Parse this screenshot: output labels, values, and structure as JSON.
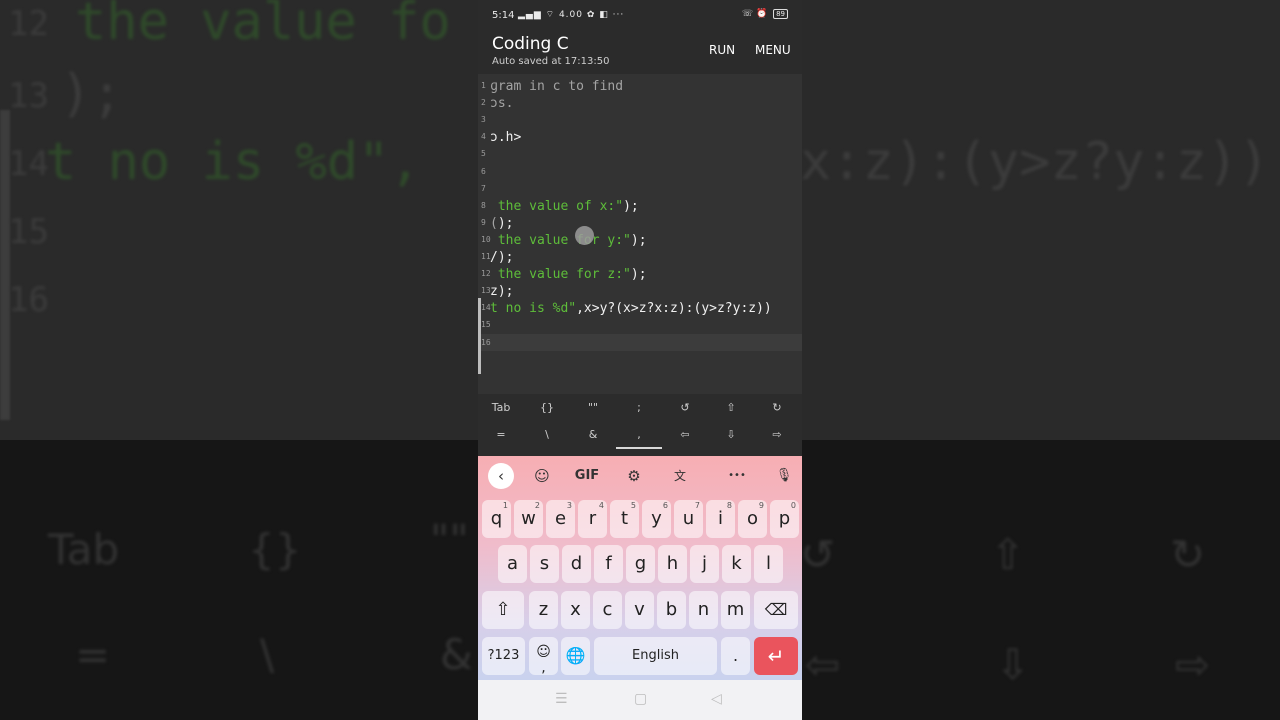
{
  "background": {
    "code_lines": [
      {
        "ln": "12",
        "text": "the value fo"
      },
      {
        "ln": "13",
        "text": ");"
      },
      {
        "ln": "14",
        "text": "t no is %d\",",
        "tail": "x:z):(y>z?y:z))"
      },
      {
        "ln": "15",
        "text": ""
      },
      {
        "ln": "16",
        "text": ""
      }
    ],
    "keys_row1": [
      "Tab",
      "{}",
      "\"\"",
      "↺",
      "⇧",
      "↻"
    ],
    "keys_row2": [
      "=",
      "\\",
      "&",
      "⇦",
      "⇩",
      "⇨"
    ]
  },
  "status_bar": {
    "time": "5:14",
    "indicators": "▂▄▆ ⌔ 4.00 ✿ ◧ ···",
    "right_icons": "☏ ⏰",
    "battery": "89"
  },
  "app": {
    "title": "Coding C",
    "subtitle": "Auto saved at 17:13:50",
    "run_label": "RUN",
    "menu_label": "MENU"
  },
  "editor": {
    "lines": [
      {
        "ln": "1",
        "parts": [
          {
            "t": "ɡram in c to find",
            "c": "c"
          }
        ]
      },
      {
        "ln": "2",
        "parts": [
          {
            "t": "ɔs.",
            "c": "c"
          }
        ]
      },
      {
        "ln": "3",
        "parts": []
      },
      {
        "ln": "4",
        "parts": [
          {
            "t": "ɔ.h>",
            "c": ""
          }
        ]
      },
      {
        "ln": "5",
        "parts": []
      },
      {
        "ln": "6",
        "parts": []
      },
      {
        "ln": "7",
        "parts": []
      },
      {
        "ln": "8",
        "parts": [
          {
            "t": " the value of x:\"",
            "c": "g"
          },
          {
            "t": ");",
            "c": ""
          }
        ]
      },
      {
        "ln": "9",
        "parts": [
          {
            "t": "(",
            "c": "c"
          },
          {
            "t": ");",
            "c": ""
          }
        ]
      },
      {
        "ln": "10",
        "parts": [
          {
            "t": " the value for y:\"",
            "c": "g"
          },
          {
            "t": ");",
            "c": ""
          }
        ]
      },
      {
        "ln": "11",
        "parts": [
          {
            "t": "/);",
            "c": ""
          }
        ]
      },
      {
        "ln": "12",
        "parts": [
          {
            "t": " the value for z:\"",
            "c": "g"
          },
          {
            "t": ");",
            "c": ""
          }
        ]
      },
      {
        "ln": "13",
        "parts": [
          {
            "t": "z);",
            "c": ""
          }
        ]
      },
      {
        "ln": "14",
        "parts": [
          {
            "t": "t no is %d\"",
            "c": "g"
          },
          {
            "t": ",x>y?(x>z?x:z):(y>z?y:z))",
            "c": ""
          }
        ]
      },
      {
        "ln": "15",
        "parts": []
      },
      {
        "ln": "16",
        "parts": []
      }
    ],
    "current_line": "16"
  },
  "extra_keys": {
    "row1": [
      "Tab",
      "{}",
      "\"\"",
      ";",
      "↺",
      "⇧",
      "↻"
    ],
    "row2": [
      "=",
      "\\",
      "&",
      ",",
      "⇦",
      "⇩",
      "⇨"
    ]
  },
  "keyboard": {
    "toolbar": {
      "back": "‹",
      "sticker": "☺",
      "gif": "GIF",
      "settings": "⚙",
      "translate": "文",
      "more": "•••",
      "mic": "🎙"
    },
    "row1": [
      {
        "k": "q",
        "n": "1"
      },
      {
        "k": "w",
        "n": "2"
      },
      {
        "k": "e",
        "n": "3"
      },
      {
        "k": "r",
        "n": "4"
      },
      {
        "k": "t",
        "n": "5"
      },
      {
        "k": "y",
        "n": "6"
      },
      {
        "k": "u",
        "n": "7"
      },
      {
        "k": "i",
        "n": "8"
      },
      {
        "k": "o",
        "n": "9"
      },
      {
        "k": "p",
        "n": "0"
      }
    ],
    "row2": [
      "a",
      "s",
      "d",
      "f",
      "g",
      "h",
      "j",
      "k",
      "l"
    ],
    "row3": [
      "z",
      "x",
      "c",
      "v",
      "b",
      "n",
      "m"
    ],
    "shift": "⇧",
    "backspace": "⌫",
    "symbols": "?123",
    "emoji": "☺",
    "comma": ",",
    "globe": "🌐",
    "space": "English",
    "period": ".",
    "enter": "↵"
  },
  "navbar": {
    "menu": "☰",
    "home": "▢",
    "back": "◁"
  }
}
